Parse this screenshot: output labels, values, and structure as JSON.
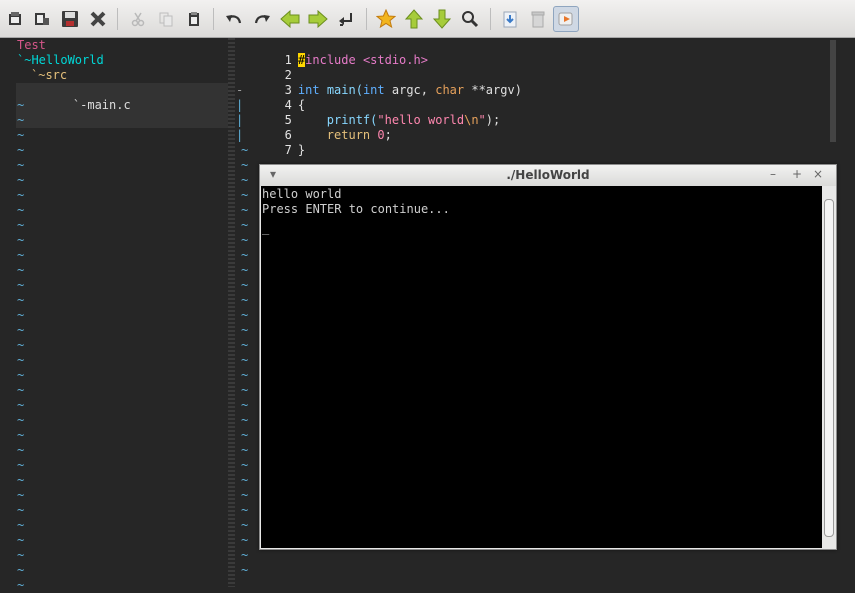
{
  "toolbar": {
    "buttons": [
      {
        "name": "new-file-icon"
      },
      {
        "name": "open-file-icon"
      },
      {
        "name": "save-file-icon"
      },
      {
        "name": "close-file-icon"
      },
      {
        "name": "cut-icon"
      },
      {
        "name": "copy-icon"
      },
      {
        "name": "paste-icon"
      },
      {
        "name": "undo-icon"
      },
      {
        "name": "redo-icon"
      },
      {
        "name": "back-arrow-icon"
      },
      {
        "name": "forward-arrow-icon"
      },
      {
        "name": "jump-icon"
      },
      {
        "name": "bookmark-star-icon"
      },
      {
        "name": "up-arrow-icon"
      },
      {
        "name": "down-arrow-icon"
      },
      {
        "name": "find-icon"
      },
      {
        "name": "load-session-icon"
      },
      {
        "name": "trash-icon"
      },
      {
        "name": "run-icon"
      }
    ]
  },
  "tree": {
    "root": "Test",
    "project": "`~HelloWorld",
    "folder": "`~src",
    "file": "`-main.c",
    "tilde": "~"
  },
  "editor": {
    "line_numbers": [
      "1",
      "2",
      "3",
      "4",
      "5",
      "6",
      "7"
    ],
    "fold_marks": [
      "-",
      "|",
      "|",
      "|"
    ],
    "code": {
      "l1_hash": "#",
      "l1_rest": "include <stdio.h>",
      "l3_type": "int",
      "l3_fn": " main(",
      "l3_int": "int",
      "l3_mid": " argc, ",
      "l3_char": "char",
      "l3_end": " **argv)",
      "l4": "{",
      "l5_fn": "    printf(",
      "l5_str1": "\"hello world",
      "l5_esc": "\\n",
      "l5_str2": "\"",
      "l5_end": ");",
      "l6_kw": "    return ",
      "l6_num": "0",
      "l6_end": ";",
      "l7": "}"
    },
    "tilde": "~"
  },
  "terminal": {
    "title": "./HelloWorld",
    "lines": [
      "hello world",
      "Press ENTER to continue...",
      "_"
    ],
    "controls": {
      "menu": "▾",
      "minimize": "–",
      "maximize": "+",
      "close": "×"
    }
  }
}
